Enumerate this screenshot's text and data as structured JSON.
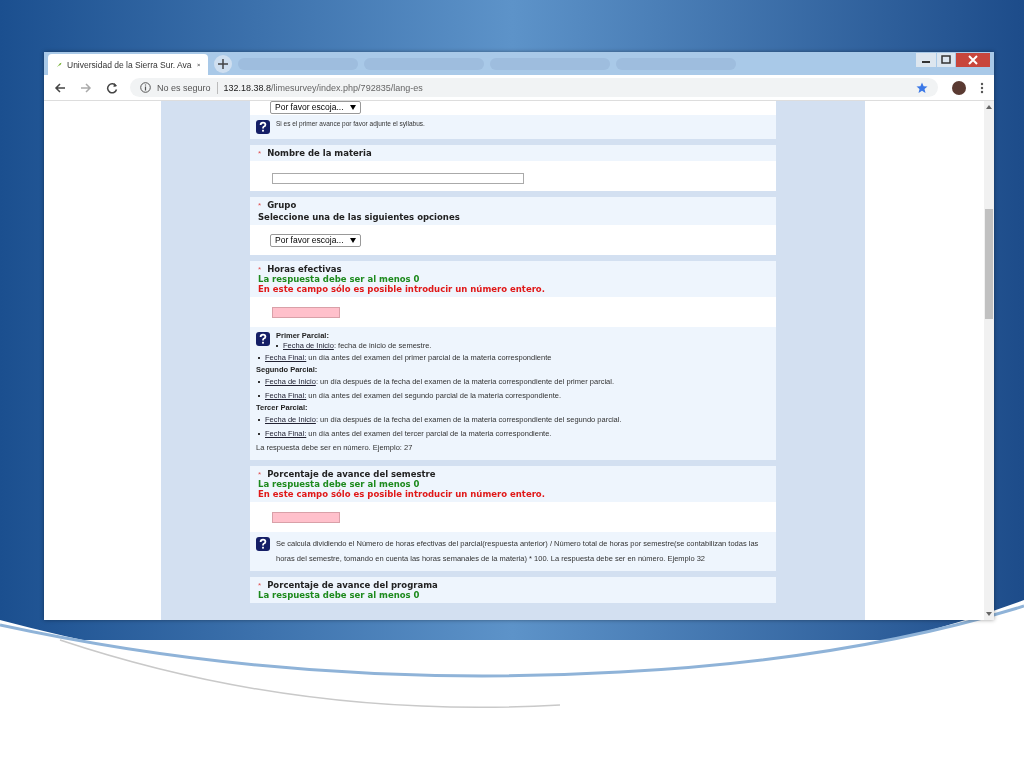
{
  "browser": {
    "tab_title": "Universidad de la Sierra Sur. Ava",
    "security": "No es seguro",
    "url_host": "132.18.38.8",
    "url_path": "/limesurvey/index.php/792835/lang-es"
  },
  "questions": [
    {
      "answer": {
        "kind": "select",
        "value": "Por favor escoja..."
      },
      "help": {
        "kind": "plain",
        "text": "Si es el primer avance por favor adjunte el syllabus."
      }
    },
    {
      "required_mark": "*",
      "title": "Nombre de la materia",
      "answer": {
        "kind": "text",
        "invalid": false
      }
    },
    {
      "required_mark": "*",
      "title": "Grupo",
      "subtitle": "Seleccione una de las siguientes opciones",
      "answer": {
        "kind": "select",
        "value": "Por favor escoja..."
      }
    },
    {
      "required_mark": "*",
      "title": "Horas efectivas",
      "tips": [
        {
          "text": "La respuesta debe ser al menos 0",
          "kind": "ok"
        },
        {
          "text": "En este campo sólo es posible introducir un número entero.",
          "kind": "error"
        }
      ],
      "answer": {
        "kind": "text",
        "invalid": true
      },
      "help": {
        "kind": "list",
        "sections": [
          {
            "heading": "Primer Parcial:",
            "items": [
              {
                "link": "Fecha de Inicio",
                "text": ": fecha de inicio de semestre."
              },
              {
                "link": "Fecha Final:",
                "text": " un día antes del examen del primer parcial de la materia correspondiente"
              }
            ]
          },
          {
            "heading": "Segundo Parcial:",
            "items": [
              {
                "link": "Fecha de Inicio",
                "text": ": un día después de la fecha del examen de la materia correspondiente del primer parcial."
              },
              {
                "link": "Fecha Final:",
                "text": " un día antes del examen del segundo parcial de la materia correspondiente."
              }
            ]
          },
          {
            "heading": "Tercer  Parcial:",
            "items": [
              {
                "link": "Fecha de Inicio",
                "text": ": un día después de la fecha del examen de la materia correspondiente del segundo parcial."
              },
              {
                "link": "Fecha Final:",
                "text": " un día antes del examen del tercer parcial de la materia correspondiente."
              }
            ]
          }
        ],
        "footer": "La respuesta debe ser en número. Ejemplo: 27"
      }
    },
    {
      "required_mark": "*",
      "title": "Porcentaje de avance del semestre",
      "tips": [
        {
          "text": "La respuesta debe ser al menos 0",
          "kind": "ok"
        },
        {
          "text": "En este campo sólo es posible introducir un número entero.",
          "kind": "error"
        }
      ],
      "answer": {
        "kind": "text",
        "invalid": true
      },
      "help": {
        "kind": "plain",
        "text": "Se calcula dividiendo el Número de horas efectivas del parcial(respuesta anterior) / Número total de horas por semestre(se contabilizan todas las horas del semestre, tomando en cuenta las horas semanales de la materia) * 100. La respuesta debe ser en número. Ejemplo 32"
      }
    },
    {
      "required_mark": "*",
      "title": "Porcentaje de avance del programa",
      "tips": [
        {
          "text": "La respuesta debe ser al menos 0",
          "kind": "ok"
        }
      ]
    }
  ]
}
